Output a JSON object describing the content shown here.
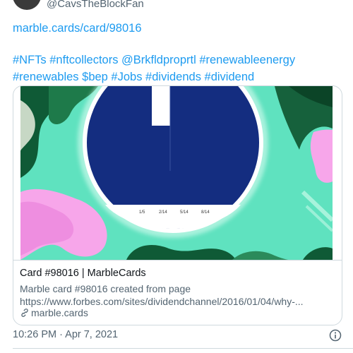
{
  "tweet": {
    "author_handle": "@CavsTheBlockFan",
    "link_line": "marble.cards/card/98016",
    "hashtags_line1": "#NFTs #nftcollectors @Brkfldproprtl #renewableenergy",
    "hashtags_line2": "#renewables $bep #Jobs #dividends #dividend",
    "timestamp": "10:26 PM · Apr 7, 2021"
  },
  "card": {
    "title": "Card #98016 | MarbleCards",
    "description_line1": "Marble card #98016 created from page",
    "description_line2": "https://www.forbes.com/sites/dividendchannel/2016/01/04/why-...",
    "domain": "marble.cards",
    "chart_ticks": [
      "1/5",
      "2/14",
      "5/14",
      "8/14"
    ]
  },
  "colors": {
    "link": "#1d9bf0",
    "secondary_text": "#536471",
    "card_navy": "#142d80",
    "card_mint": "#5fe2bf",
    "card_pink": "#f7a6ea",
    "card_green": "#0f5a36"
  },
  "icons": {
    "domain": "link-icon",
    "info": "info-icon"
  }
}
